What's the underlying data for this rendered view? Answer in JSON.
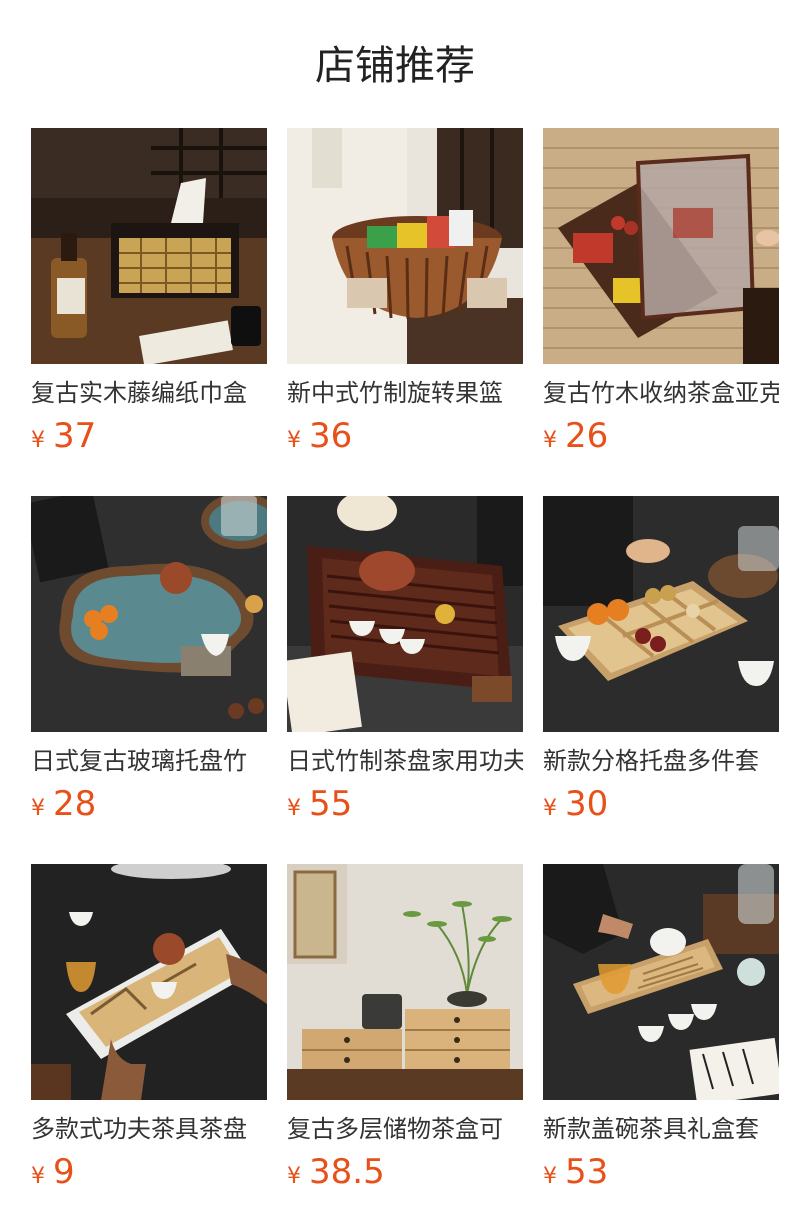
{
  "page": {
    "title": "店铺推荐"
  },
  "products": [
    {
      "name": "复古实木藤编纸巾盒",
      "currency": "¥",
      "price": "37",
      "image_icon": "tissue-box-image"
    },
    {
      "name": "新中式竹制旋转果篮",
      "currency": "¥",
      "price": "36",
      "image_icon": "fruit-basket-image"
    },
    {
      "name": "复古竹木收纳茶盒亚克力",
      "currency": "¥",
      "price": "26",
      "image_icon": "storage-box-image"
    },
    {
      "name": "日式复古玻璃托盘竹",
      "currency": "¥",
      "price": "28",
      "image_icon": "glass-tray-image"
    },
    {
      "name": "日式竹制茶盘家用功夫",
      "currency": "¥",
      "price": "55",
      "image_icon": "tea-tray-image"
    },
    {
      "name": "新款分格托盘多件套",
      "currency": "¥",
      "price": "30",
      "image_icon": "divided-tray-image"
    },
    {
      "name": "多款式功夫茶具茶盘",
      "currency": "¥",
      "price": "9",
      "image_icon": "kungfu-tray-image"
    },
    {
      "name": "复古多层储物茶盒可",
      "currency": "¥",
      "price": "38.5",
      "image_icon": "drawer-box-image"
    },
    {
      "name": "新款盖碗茶具礼盒套",
      "currency": "¥",
      "price": "53",
      "image_icon": "gaiwan-set-image"
    }
  ]
}
